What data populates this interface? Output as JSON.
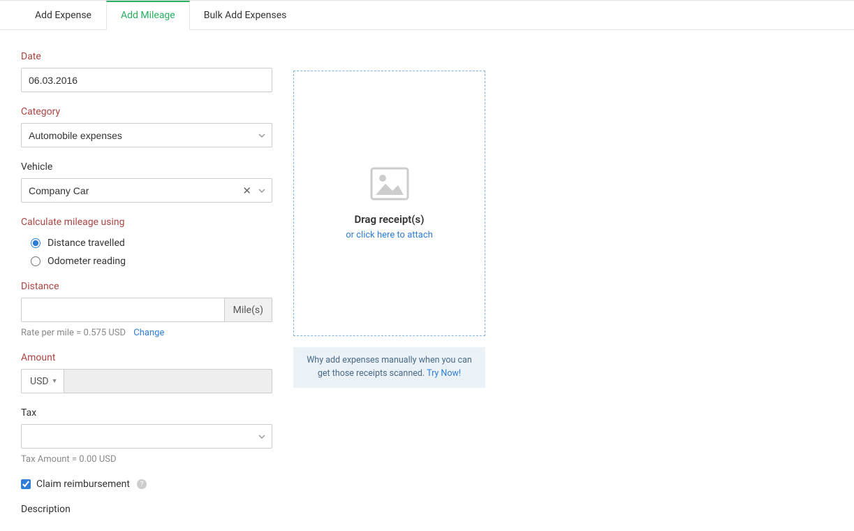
{
  "tabs": {
    "add_expense": "Add Expense",
    "add_mileage": "Add Mileage",
    "bulk_add": "Bulk Add Expenses"
  },
  "form": {
    "date_label": "Date",
    "date_value": "06.03.2016",
    "category_label": "Category",
    "category_value": "Automobile expenses",
    "vehicle_label": "Vehicle",
    "vehicle_value": "Company Car",
    "calc_label": "Calculate mileage using",
    "radio_distance": "Distance travelled",
    "radio_odometer": "Odometer reading",
    "distance_label": "Distance",
    "distance_unit": "Mile(s)",
    "rate_note": "Rate per mile = 0.575 USD",
    "rate_change": "Change",
    "amount_label": "Amount",
    "amount_currency": "USD",
    "tax_label": "Tax",
    "tax_amount_note": "Tax Amount = 0.00  USD",
    "claim_label": "Claim reimbursement",
    "description_label": "Description"
  },
  "upload": {
    "drag_text": "Drag receipt(s)",
    "click_text": "or click here to attach",
    "banner_text": "Why add expenses manually when you can get those receipts scanned. ",
    "banner_link": "Try Now!"
  }
}
